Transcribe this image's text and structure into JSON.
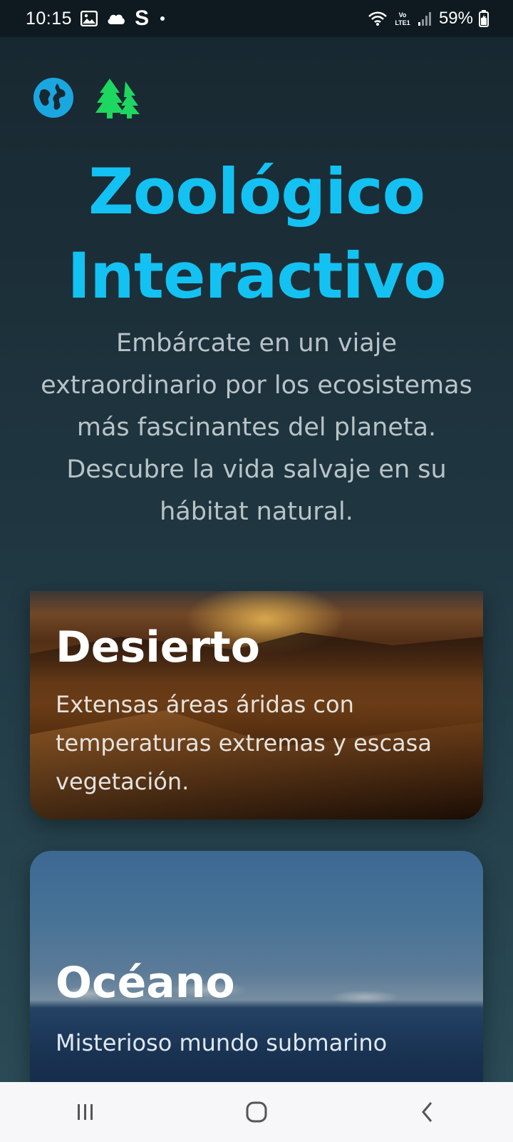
{
  "status_bar": {
    "time": "10:15",
    "notif_letter": "S",
    "battery": "59%",
    "icons": [
      "image-icon",
      "cloud-icon",
      "s-app-icon",
      "dot-icon",
      "wifi-icon",
      "volte-icon",
      "signal-icon",
      "battery-icon"
    ]
  },
  "header": {
    "icons": [
      "globe-icon",
      "forest-icon"
    ],
    "title_line1": "Zoológico",
    "title_line2": "Interactivo",
    "subtitle": "Embárcate en un viaje extraordinario por los ecosistemas más fascinantes del planeta. Descubre la vida salvaje en su hábitat natural."
  },
  "cards": [
    {
      "title": "Desierto",
      "description": "Extensas áreas áridas con temperaturas extremas y escasa vegetación."
    },
    {
      "title": "Océano",
      "description": "Misterioso mundo submarino"
    }
  ],
  "nav_bar": {
    "icons": [
      "recent-apps-icon",
      "home-icon",
      "back-icon"
    ]
  },
  "colors": {
    "title": "#13c2f2",
    "globe": "#1aa7e0",
    "forest": "#1ed760",
    "subtitle": "#b9c3c7",
    "nav_background": "#f7f7f9"
  }
}
